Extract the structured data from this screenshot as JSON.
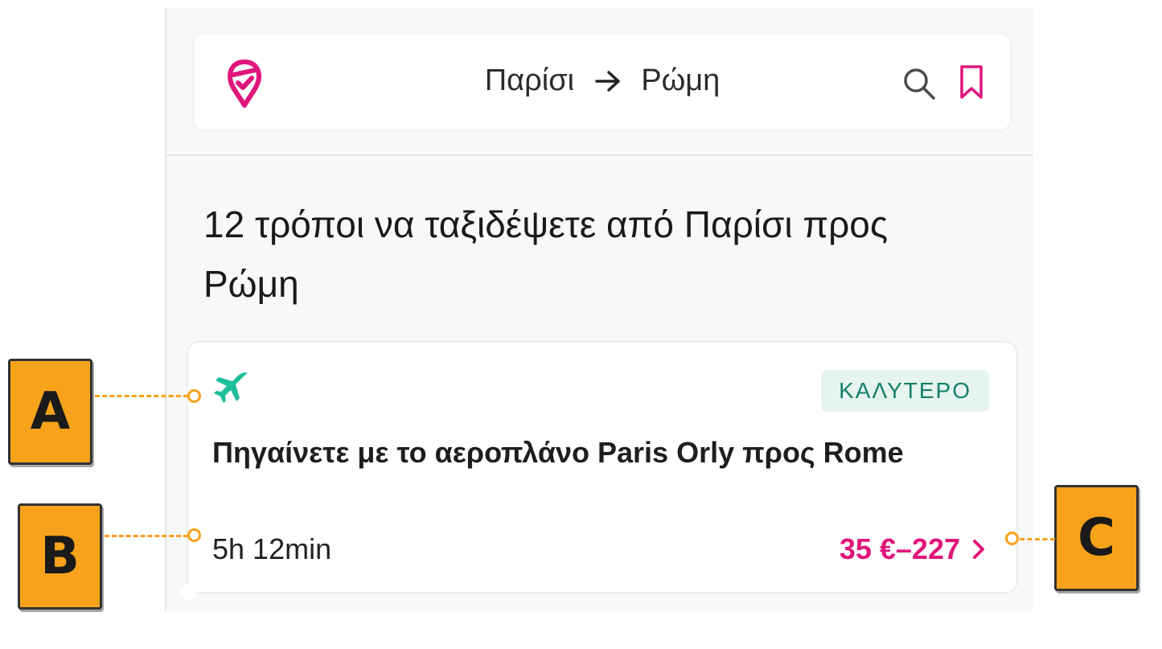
{
  "header": {
    "logo_icon": "omio-logo-icon",
    "origin": "Παρίσι",
    "destination": "Ρώμη",
    "arrow_icon": "arrow-right-icon",
    "search_icon": "search-icon",
    "bookmark_icon": "bookmark-icon"
  },
  "page_title": "12 τρόποι να ταξιδέψετε από Παρίσι προς Ρώμη",
  "result_card": {
    "mode_icon": "airplane-icon",
    "badge": "ΚΑΛΥΤΕΡΟ",
    "title": "Πηγαίνετε με το αεροπλάνο Paris Orly προς Rome",
    "duration": "5h 12min",
    "price": "35 €–227",
    "chevron_icon": "chevron-right-icon"
  },
  "annotations": {
    "a": "A",
    "b": "B",
    "c": "C"
  },
  "colors": {
    "brand": "#e0157b",
    "plane": "#1fbf9b",
    "badge_bg": "#e5f4ee",
    "badge_text": "#14806a",
    "annotation": "#f7a21b"
  }
}
